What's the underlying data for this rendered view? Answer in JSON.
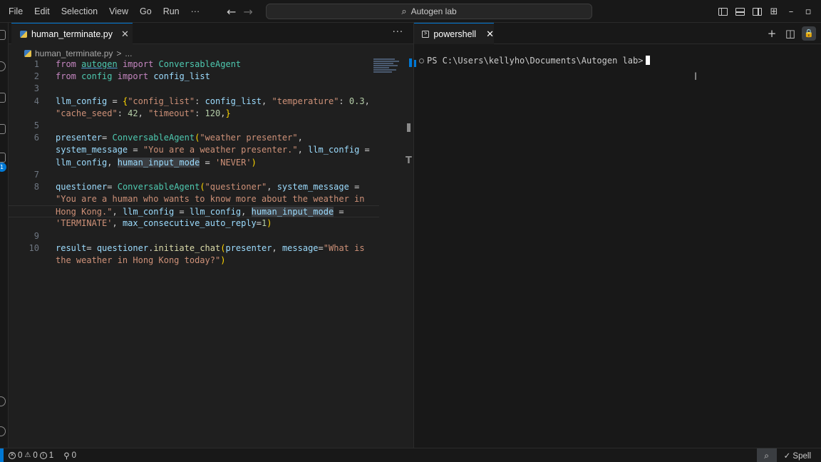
{
  "menu": [
    "File",
    "Edit",
    "Selection",
    "View",
    "Go",
    "Run",
    "···"
  ],
  "nav": {
    "back": "←",
    "forward": "→"
  },
  "command_center": {
    "text": "Autogen lab"
  },
  "window_controls": {
    "minimize": "–",
    "restore": "▫"
  },
  "editor": {
    "tab": {
      "filename": "human_terminate.py",
      "close": "✕"
    },
    "more_actions": "···",
    "breadcrumb": {
      "file": "human_terminate.py",
      "sep": ">",
      "rest": "..."
    },
    "lines": [
      {
        "n": "1"
      },
      {
        "n": "2"
      },
      {
        "n": "3"
      },
      {
        "n": "4"
      },
      {
        "n": ""
      },
      {
        "n": "5"
      },
      {
        "n": "6"
      },
      {
        "n": ""
      },
      {
        "n": ""
      },
      {
        "n": "7"
      },
      {
        "n": "8"
      },
      {
        "n": ""
      },
      {
        "n": ""
      },
      {
        "n": ""
      },
      {
        "n": "9"
      },
      {
        "n": "10"
      },
      {
        "n": ""
      }
    ]
  },
  "terminal": {
    "tab": {
      "name": "powershell",
      "close": "✕"
    },
    "actions": {
      "new": "+",
      "split": "◫",
      "lock": "🔒"
    },
    "prompt": "PS C:\\Users\\kellyho\\Documents\\Autogen lab>"
  },
  "statusbar": {
    "errors": "0",
    "warnings": "0",
    "info": "1",
    "ports": "0",
    "spell": "Spell"
  },
  "colors": {
    "accent": "#0078d4",
    "keyword": "#c586c0",
    "string": "#ce9178",
    "class": "#4ec9b0"
  }
}
